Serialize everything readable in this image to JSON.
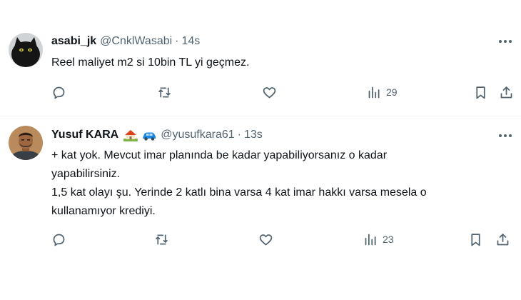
{
  "tweets": [
    {
      "display_name": "asabi_jk",
      "handle": "@CnklWasabi",
      "separator": "·",
      "time": "14s",
      "text_lines": [
        "Reel maliyet m2 si 10bin TL yi geçmez."
      ],
      "views": "29",
      "avatar": "black-cat-avatar"
    },
    {
      "display_name": "Yusuf KARA",
      "name_emojis": [
        "house-emoji",
        "car-emoji"
      ],
      "handle": "@yusufkara61",
      "separator": "·",
      "time": "13s",
      "text_lines": [
        "+ kat yok. Mevcut imar planında be kadar yapabiliyorsanız o kadar",
        "yapabilirsiniz.",
        "1,5 kat olayı şu. Yerinde 2 katlı bina varsa 4 kat imar hakkı varsa mesela o",
        "kullanamıyor krediyi."
      ],
      "views": "23",
      "avatar": "man-portrait-avatar"
    }
  ],
  "icons": {
    "more": "more-icon",
    "reply": "reply-icon",
    "repost": "repost-icon",
    "like": "like-icon",
    "views": "views-icon",
    "bookmark": "bookmark-icon",
    "share": "share-icon"
  },
  "colors": {
    "text_primary": "#0f1419",
    "text_secondary": "#536471",
    "divider": "#eff3f4",
    "background": "#ffffff"
  }
}
